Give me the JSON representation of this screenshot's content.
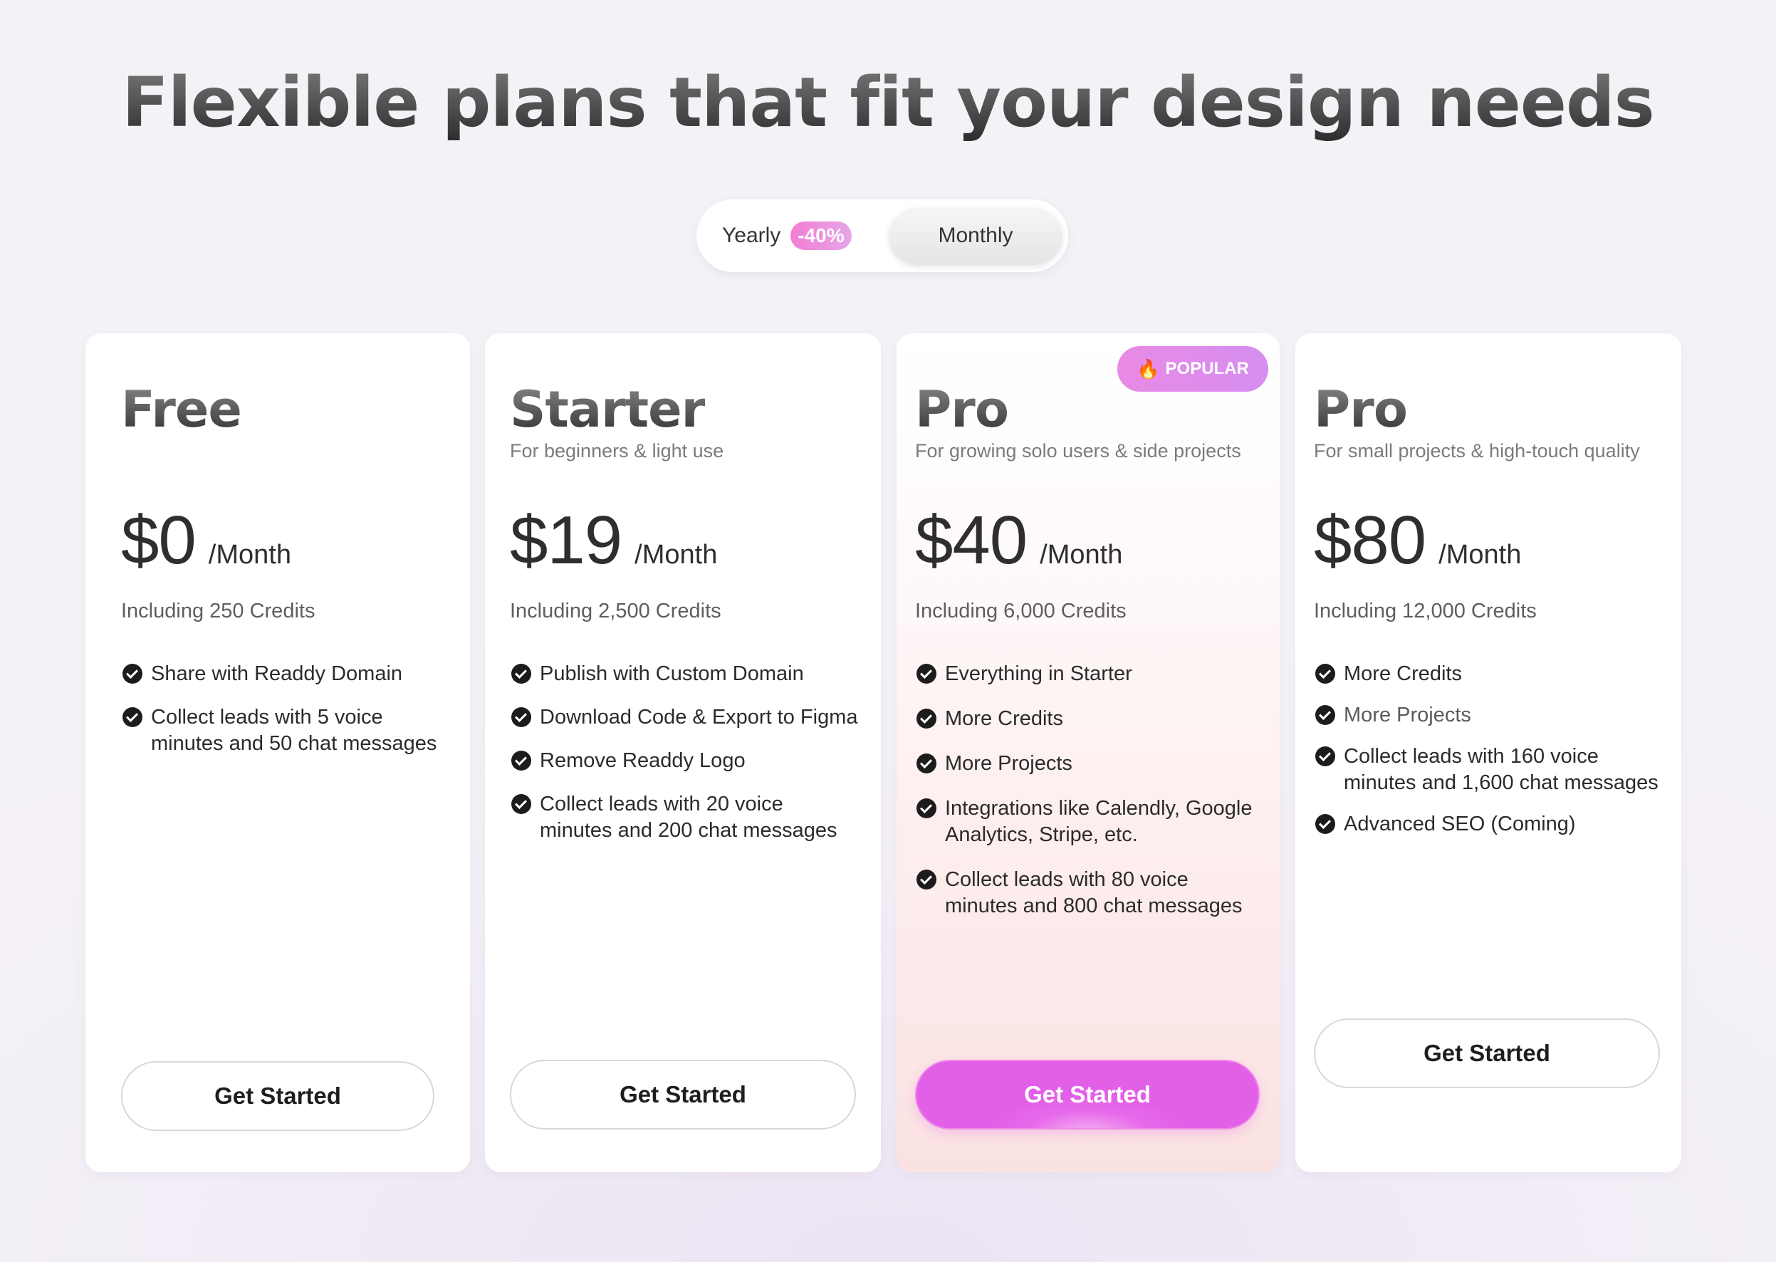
{
  "header": {
    "title": "Flexible plans that fit your design needs"
  },
  "billing_toggle": {
    "yearly_label": "Yearly",
    "yearly_discount": "-40%",
    "monthly_label": "Monthly",
    "selected": "Monthly"
  },
  "plans": [
    {
      "name": "Free",
      "subtitle": "",
      "price": "$0",
      "period": "/Month",
      "credits": "Including 250 Credits",
      "features": [
        [
          "Share with Readdy Domain"
        ],
        [
          "Collect leads with 5 voice",
          "minutes and 50 chat messages"
        ]
      ],
      "cta": "Get Started"
    },
    {
      "name": "Starter",
      "subtitle": "For beginners & light use",
      "price": "$19",
      "period": "/Month",
      "credits": "Including 2,500 Credits",
      "features": [
        [
          "Publish with Custom Domain"
        ],
        [
          "Download Code & Export to Figma"
        ],
        [
          "Remove Readdy Logo"
        ],
        [
          "Collect leads with 20 voice",
          "minutes and 200 chat messages"
        ]
      ],
      "cta": "Get Started"
    },
    {
      "name": "Pro",
      "subtitle": "For growing solo users & side projects",
      "price": "$40",
      "period": "/Month",
      "credits": "Including 6,000 Credits",
      "badge": "POPULAR",
      "badge_icon": "flame-icon",
      "features": [
        [
          "Everything in Starter"
        ],
        [
          "More Credits"
        ],
        [
          "More Projects"
        ],
        [
          "Integrations like Calendly, Google",
          "Analytics, Stripe, etc."
        ],
        [
          "Collect leads with 80 voice",
          "minutes and 800 chat messages"
        ]
      ],
      "cta": "Get Started"
    },
    {
      "name": "Pro",
      "subtitle": "For small projects & high-touch quality",
      "price": "$80",
      "period": "/Month",
      "credits": "Including 12,000 Credits",
      "features": [
        [
          "More Credits"
        ],
        [
          "More Projects"
        ],
        [
          "Collect leads with 160 voice",
          "minutes and 1,600 chat messages"
        ],
        [
          "Advanced SEO (Coming)"
        ]
      ],
      "cta": "Get Started"
    }
  ],
  "colors": {
    "accent": "#e25fe8",
    "badge": "#e98ae5",
    "text_dark": "#2e2e2e"
  }
}
